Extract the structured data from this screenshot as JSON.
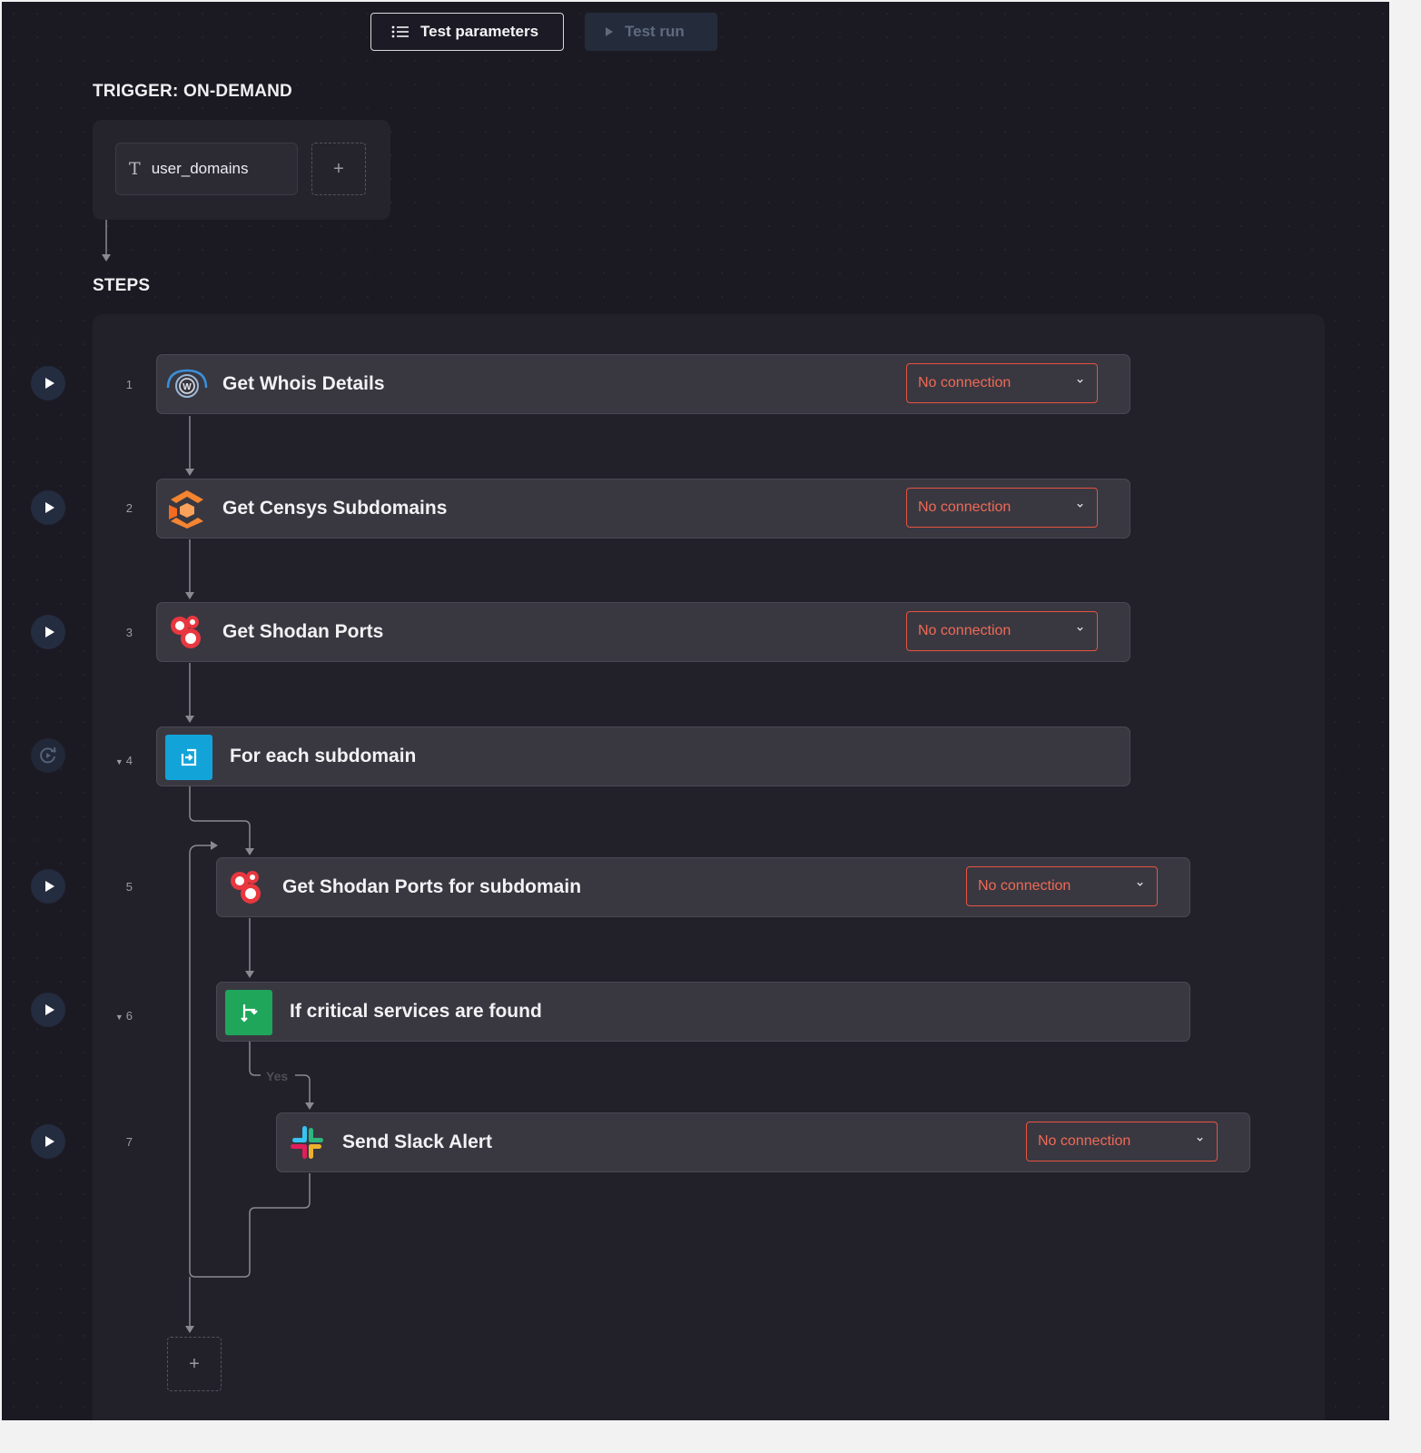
{
  "toolbar": {
    "test_parameters_label": "Test parameters",
    "test_run_label": "Test run"
  },
  "trigger": {
    "heading": "TRIGGER: ON-DEMAND",
    "parameter_name": "user_domains",
    "add_label": "+"
  },
  "steps": {
    "heading": "STEPS",
    "add_label": "+",
    "items": [
      {
        "number": "1",
        "title": "Get Whois Details",
        "icon": "whois-icon",
        "connection": "No connection"
      },
      {
        "number": "2",
        "title": "Get Censys Subdomains",
        "icon": "censys-icon",
        "connection": "No connection"
      },
      {
        "number": "3",
        "title": "Get Shodan Ports",
        "icon": "shodan-icon",
        "connection": "No connection"
      },
      {
        "number": "4",
        "title": "For each subdomain",
        "icon": "loop-icon"
      },
      {
        "number": "5",
        "title": "Get Shodan Ports for subdomain",
        "icon": "shodan-icon",
        "connection": "No connection"
      },
      {
        "number": "6",
        "title": "If critical services are found",
        "icon": "branch-icon"
      },
      {
        "number": "7",
        "title": "Send Slack Alert",
        "icon": "slack-icon",
        "connection": "No connection"
      }
    ],
    "branch_label": "Yes"
  },
  "colors": {
    "background": "#1b1a23",
    "card": "#393841",
    "connection_warning": "#e8523f",
    "loop_icon_bg": "#12a4d9",
    "branch_icon_bg": "#1fa65a"
  }
}
